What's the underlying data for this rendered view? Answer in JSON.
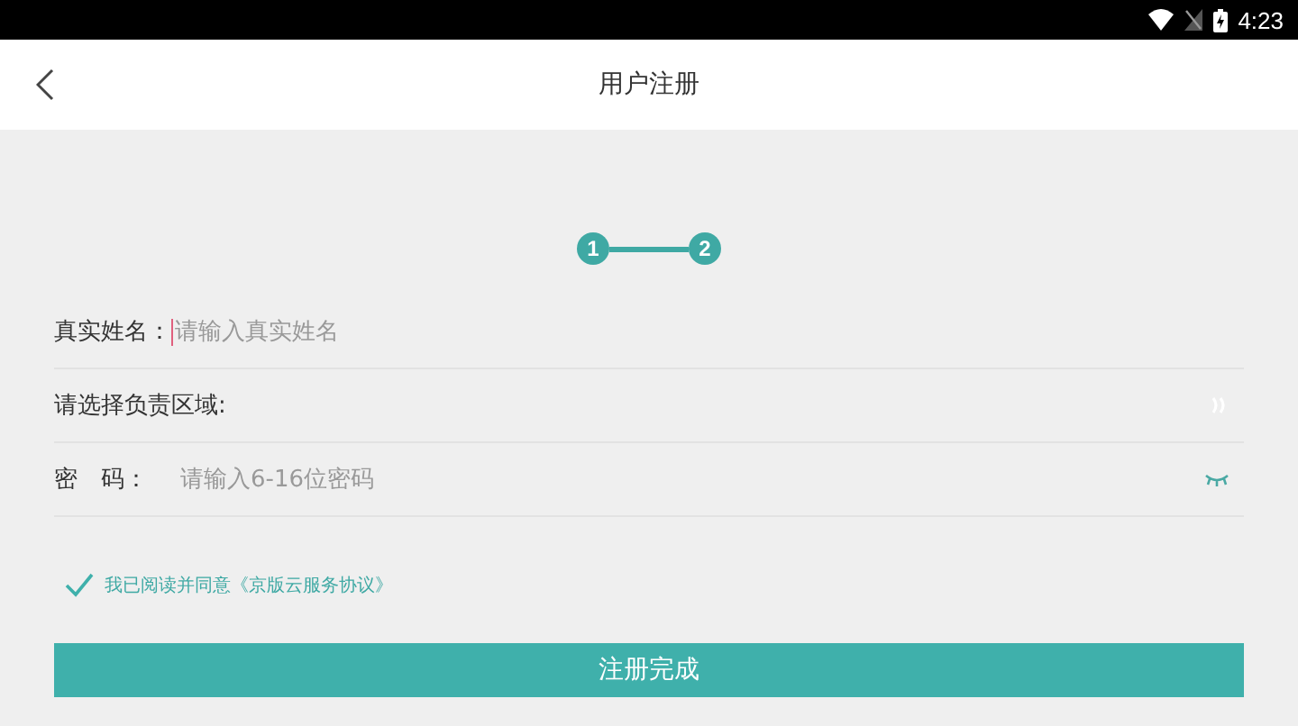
{
  "status_bar": {
    "time": "4:23"
  },
  "header": {
    "title": "用户注册"
  },
  "steps": [
    {
      "label": "1"
    },
    {
      "label": "2"
    }
  ],
  "form": [
    {
      "kind": "input",
      "label": "真实姓名：",
      "placeholder": "请输入真实姓名"
    },
    {
      "kind": "select",
      "label": "请选择负责区域:"
    },
    {
      "kind": "password",
      "label": "密　码：",
      "placeholder": "请输入6-16位密码"
    }
  ],
  "agreement": {
    "checked": true,
    "text": "我已阅读并同意《京版云服务协议》"
  },
  "submit": {
    "label": "注册完成"
  }
}
